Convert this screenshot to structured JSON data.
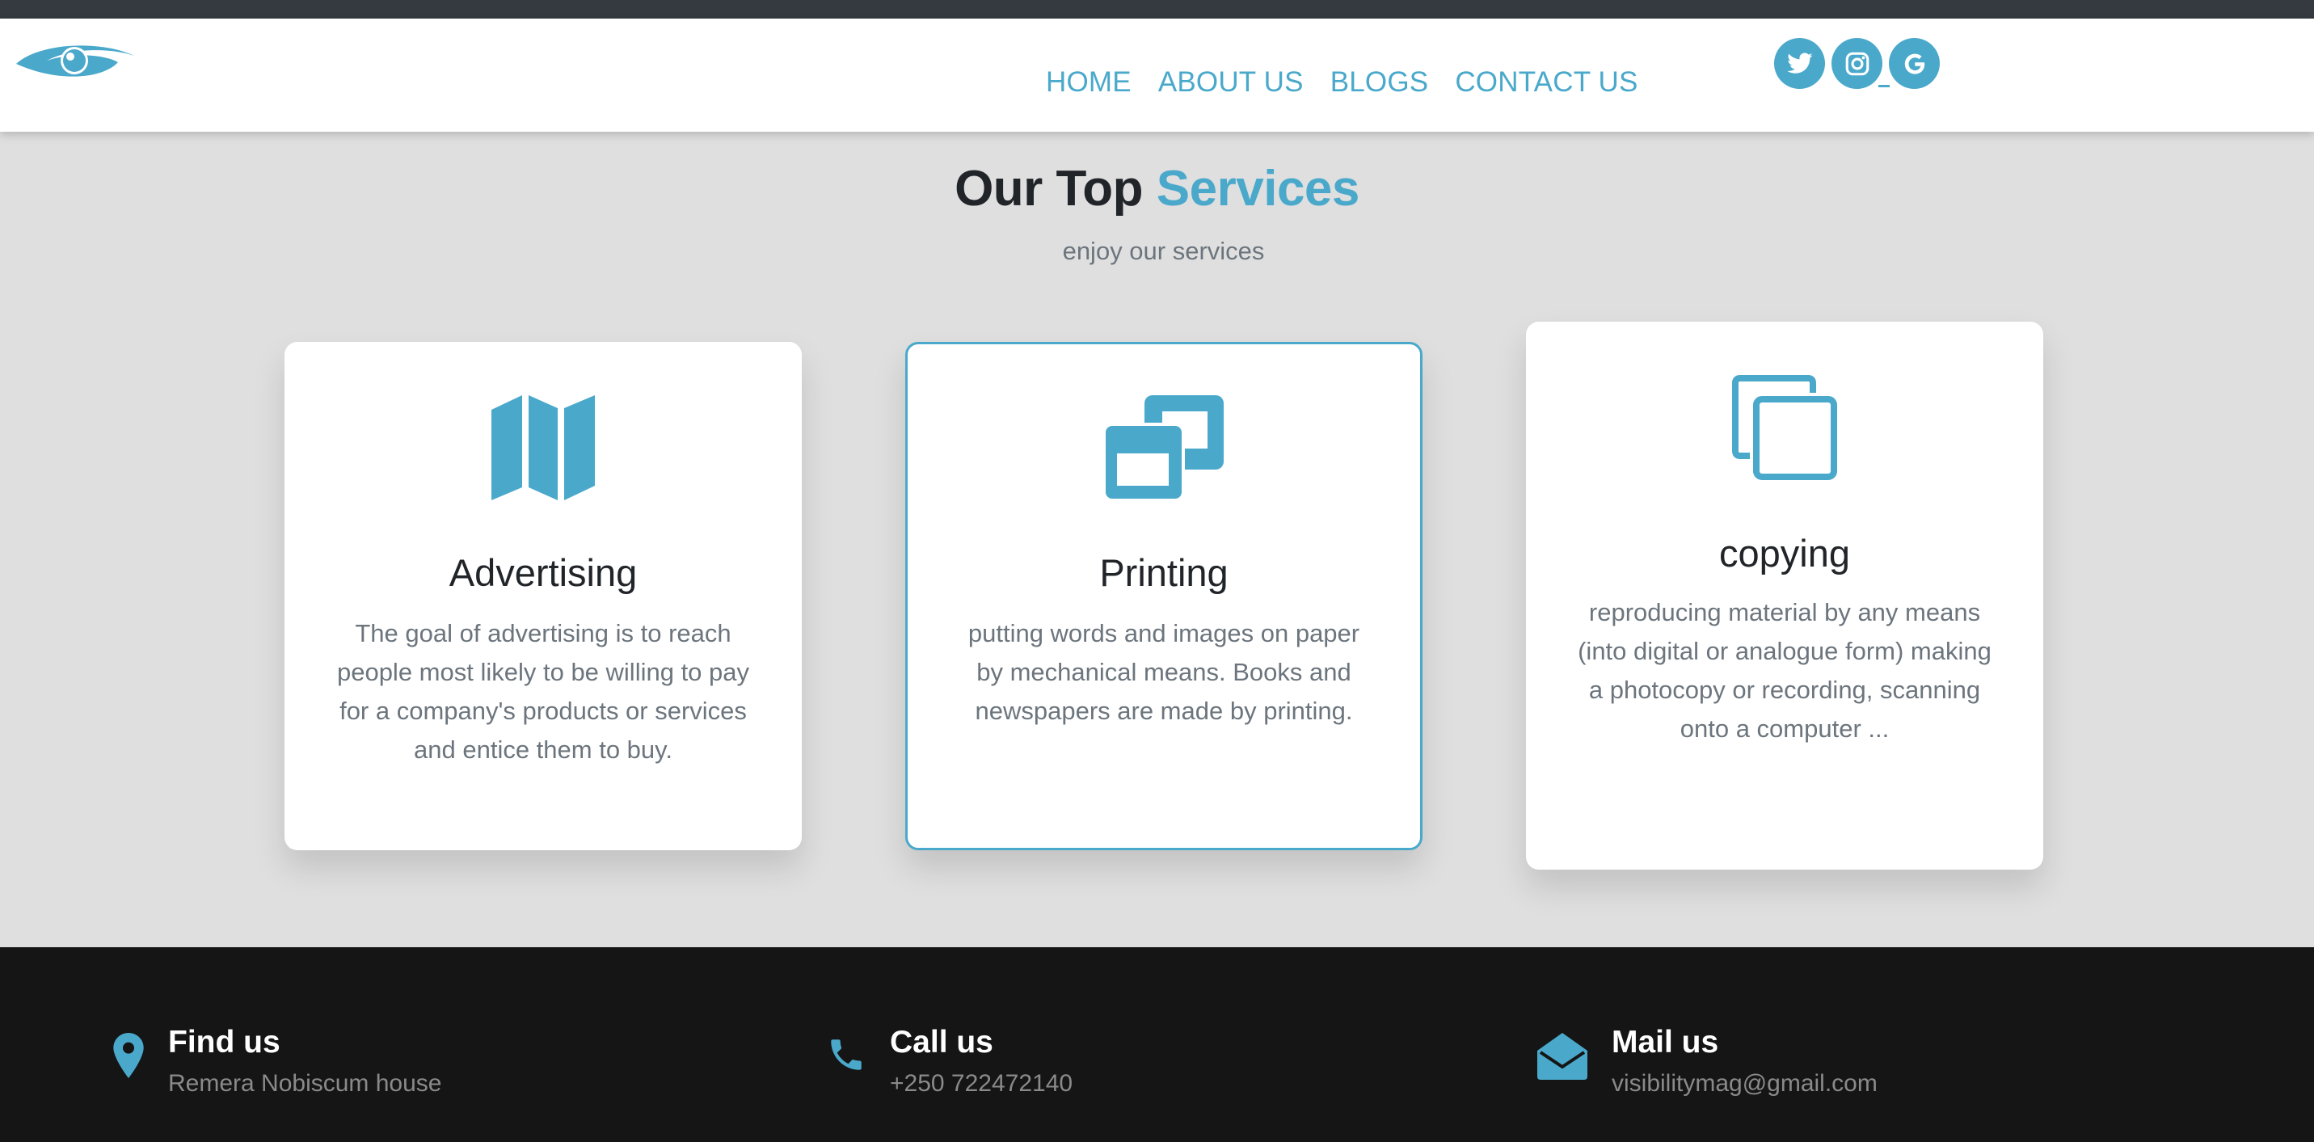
{
  "nav": {
    "links": [
      "HOME",
      "ABOUT US",
      "BLOGS",
      "CONTACT US"
    ],
    "socials": [
      "twitter-icon",
      "instagram-icon",
      "google-icon"
    ]
  },
  "services": {
    "title_prefix": "Our Top",
    "title_accent": "Services",
    "subtitle": "enjoy our services",
    "cards": [
      {
        "icon": "map-icon",
        "title": "Advertising",
        "text": "The goal of advertising is to reach people most likely to be willing to pay for a company's products or services and entice them to buy."
      },
      {
        "icon": "window-restore-icon",
        "title": "Printing",
        "text": "putting words and images on paper by mechanical means. Books and newspapers are made by printing."
      },
      {
        "icon": "copy-icon",
        "title": "copying",
        "text": "reproducing material by any means (into digital or analogue form) making a photocopy or recording, scanning onto a computer ..."
      }
    ]
  },
  "footer": {
    "find": {
      "icon": "map-pin-icon",
      "title": "Find us",
      "text": "Remera Nobiscum house"
    },
    "call": {
      "icon": "phone-icon",
      "title": "Call us",
      "text": "+250 722472140"
    },
    "mail": {
      "icon": "envelope-open-icon",
      "title": "Mail us",
      "text": "visibilitymag@gmail.com"
    }
  },
  "colors": {
    "accent": "#4aa9cb",
    "page_bg": "#dfdfdf",
    "footer_bg": "#151515",
    "topbar_bg": "#343a40"
  }
}
